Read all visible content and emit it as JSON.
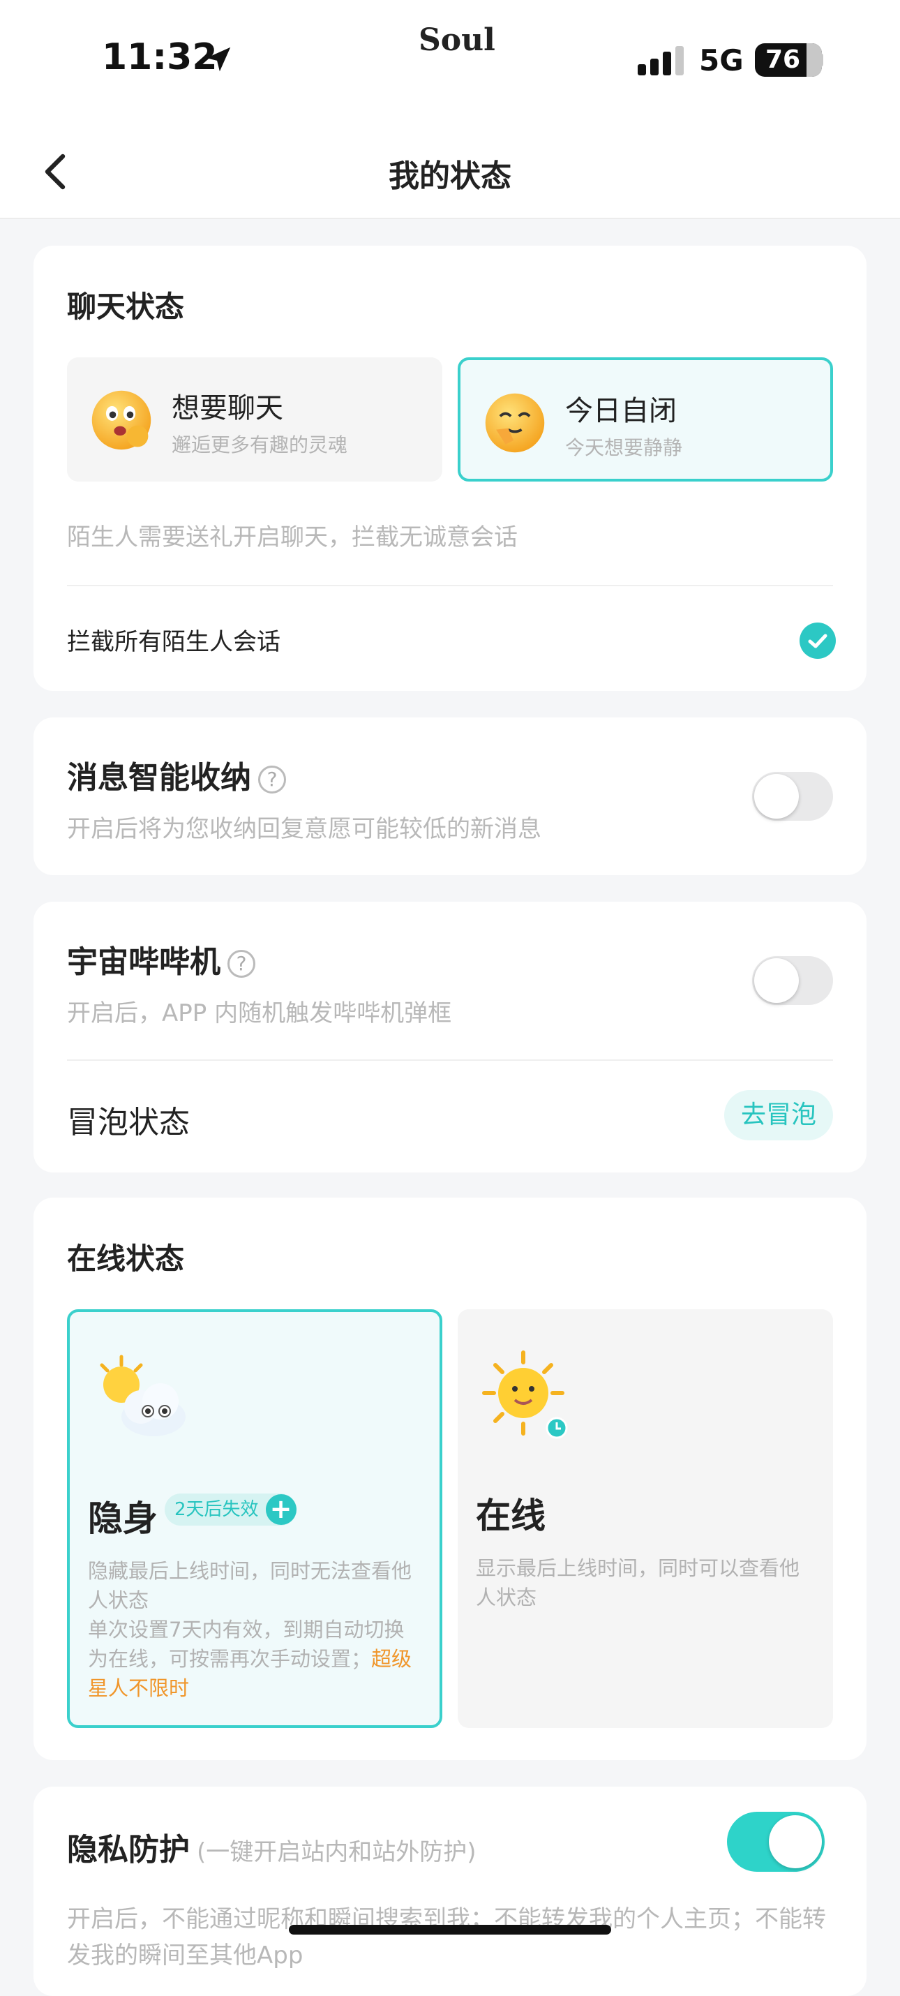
{
  "status_bar": {
    "time": "11:32",
    "brand": "Soul",
    "network": "5G",
    "battery": "76"
  },
  "nav": {
    "title": "我的状态"
  },
  "chat_status": {
    "title": "聊天状态",
    "options": [
      {
        "title": "想要聊天",
        "subtitle": "邂逅更多有趣的灵魂",
        "selected": false
      },
      {
        "title": "今日自闭",
        "subtitle": "今天想要静静",
        "selected": true
      }
    ],
    "hint": "陌生人需要送礼开启聊天，拦截无诚意会话",
    "block_all_label": "拦截所有陌生人会话",
    "block_all_checked": true
  },
  "smart_fold": {
    "title": "消息智能收纳",
    "help": "?",
    "subtitle": "开启后将为您收纳回复意愿可能较低的新消息",
    "enabled": false
  },
  "beeper": {
    "title": "宇宙哔哔机",
    "help": "?",
    "subtitle": "开启后，APP 内随机触发哔哔机弹框",
    "enabled": false,
    "bubble_label": "冒泡状态",
    "bubble_button": "去冒泡"
  },
  "online_status": {
    "title": "在线状态",
    "options": [
      {
        "name": "隐身",
        "badge": "2天后失效",
        "badge_plus": "+",
        "desc": "隐藏最后上线时间，同时无法查看他人状态",
        "desc2": "单次设置7天内有效，到期自动切换为在线，可按需再次手动设置；",
        "desc_highlight": "超级星人不限时",
        "selected": true
      },
      {
        "name": "在线",
        "desc": "显示最后上线时间，同时可以查看他人状态",
        "selected": false
      }
    ]
  },
  "privacy": {
    "title": "隐私防护",
    "title_note": "(一键开启站内和站外防护)",
    "enabled": true,
    "subtitle": "开启后，不能通过昵称和瞬间搜索到我；不能转发我的个人主页；不能转发我的瞬间至其他App"
  },
  "colors": {
    "accent": "#2cc8c4",
    "highlight": "#f0962b",
    "background": "#f5f6f8"
  }
}
